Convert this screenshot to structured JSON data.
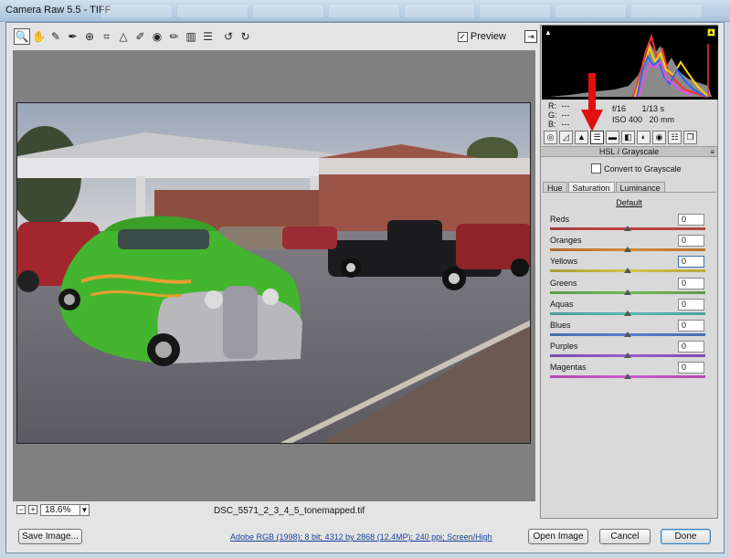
{
  "window": {
    "title": "Camera Raw 5.5  -  TIFF"
  },
  "toolbar": {
    "tools": [
      {
        "icon": "zoom-icon",
        "glyph": "🔍"
      },
      {
        "icon": "hand-icon",
        "glyph": "✋"
      },
      {
        "icon": "white-balance-icon",
        "glyph": "✎"
      },
      {
        "icon": "color-sampler-icon",
        "glyph": "✒"
      },
      {
        "icon": "target-adjust-icon",
        "glyph": "⊕"
      },
      {
        "icon": "crop-icon",
        "glyph": "⌗"
      },
      {
        "icon": "straighten-icon",
        "glyph": "△"
      },
      {
        "icon": "spot-removal-icon",
        "glyph": "✐"
      },
      {
        "icon": "red-eye-icon",
        "glyph": "◉"
      },
      {
        "icon": "adjustment-brush-icon",
        "glyph": "✏"
      },
      {
        "icon": "graduated-filter-icon",
        "glyph": "▥"
      },
      {
        "icon": "preferences-icon",
        "glyph": "☰"
      },
      {
        "icon": "rotate-left-icon",
        "glyph": "↺"
      },
      {
        "icon": "rotate-right-icon",
        "glyph": "↻"
      }
    ],
    "preview_label": "Preview",
    "preview_checked": "✓"
  },
  "zoom": {
    "minus": "−",
    "plus": "+",
    "level": "18.6%",
    "arrow": "▼"
  },
  "filename": "DSC_5571_2_3_4_5_tonemapped.tif",
  "readout": {
    "r_label": "R:",
    "r_value": "---",
    "g_label": "G:",
    "g_value": "---",
    "b_label": "B:",
    "b_value": "---"
  },
  "exif": {
    "aperture": "f/16",
    "shutter": "1/13 s",
    "iso": "ISO 400",
    "focal": "20 mm"
  },
  "panel": {
    "title": "HSL / Grayscale",
    "convert_label": "Convert to Grayscale",
    "subtabs": [
      "Hue",
      "Saturation",
      "Luminance"
    ],
    "default_label": "Default",
    "sliders": [
      {
        "label": "Reds",
        "value": "0",
        "colors": [
          "#a04040",
          "#c74040",
          "#a84a3a"
        ]
      },
      {
        "label": "Oranges",
        "value": "0",
        "colors": [
          "#b06a2a",
          "#d68a3a",
          "#b7762f"
        ]
      },
      {
        "label": "Yellows",
        "value": "0",
        "colors": [
          "#a89a3a",
          "#d4c44a",
          "#b6a83e"
        ]
      },
      {
        "label": "Greens",
        "value": "0",
        "colors": [
          "#5a9a4a",
          "#73b85a",
          "#5f9a48"
        ]
      },
      {
        "label": "Aquas",
        "value": "0",
        "colors": [
          "#4a9a9a",
          "#5ab8b8",
          "#4e9f9f"
        ]
      },
      {
        "label": "Blues",
        "value": "0",
        "colors": [
          "#4a6ab0",
          "#5a7fd0",
          "#4a6ab0"
        ]
      },
      {
        "label": "Purples",
        "value": "0",
        "colors": [
          "#7a4ab0",
          "#9a5ad0",
          "#7e4ab0"
        ]
      },
      {
        "label": "Magentas",
        "value": "0",
        "colors": [
          "#b04ab0",
          "#d05ad0",
          "#b04ab0"
        ]
      }
    ]
  },
  "bottom": {
    "save_label": "Save Image...",
    "info": "Adobe RGB (1998); 8 bit; 4312 by 2868 (12.4MP); 240 ppi; Screen/High",
    "open_label": "Open Image",
    "cancel_label": "Cancel",
    "done_label": "Done"
  }
}
